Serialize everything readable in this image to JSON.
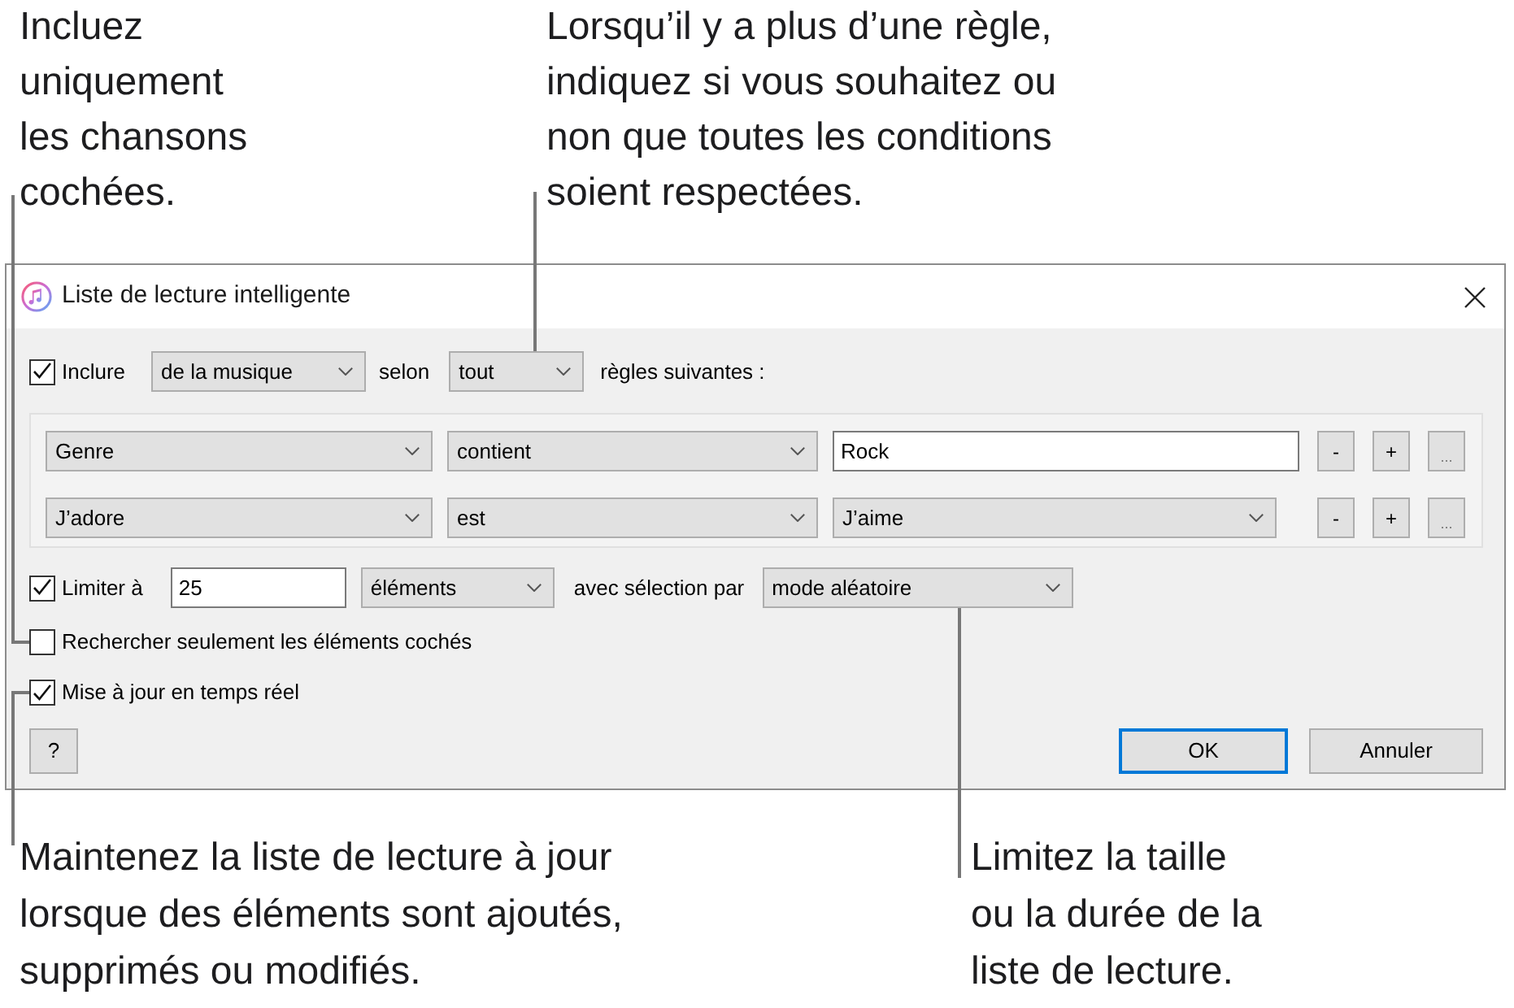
{
  "callouts_top": [
    {
      "lines": [
        "Incluez",
        "uniquement",
        "les chansons",
        "cochées."
      ]
    },
    {
      "lines": [
        "Lorsqu’il y a plus d’une règle,",
        "indiquez si vous souhaitez ou",
        "non que toutes les conditions",
        "soient respectées."
      ]
    }
  ],
  "dialog": {
    "title": "Liste de lecture intelligente",
    "include": {
      "checked": true,
      "label": "Inclure",
      "media": "de la musique",
      "connector": "selon",
      "match": "tout",
      "suffix": "règles suivantes :"
    },
    "rules": [
      {
        "kind": "text",
        "field": "Genre",
        "operator": "contient",
        "value": "Rock",
        "buttons": [
          "-",
          "+",
          "..."
        ]
      },
      {
        "kind": "choice",
        "field": "J’adore",
        "operator": "est",
        "value": "J’aime",
        "buttons": [
          "-",
          "+",
          "..."
        ]
      }
    ],
    "limit": {
      "checked": true,
      "label": "Limiter à",
      "amount": "25",
      "unit": "éléments",
      "selection_label": "avec sélection par",
      "selection": "mode aléatoire"
    },
    "only_checked": {
      "checked": false,
      "label": "Rechercher seulement les éléments cochés"
    },
    "live_update": {
      "checked": true,
      "label": "Mise à jour en temps réel"
    },
    "help_button": "?",
    "buttons": [
      {
        "label": "OK",
        "default": true
      },
      {
        "label": "Annuler",
        "default": false
      }
    ]
  },
  "callouts_bottom": [
    {
      "lines": [
        "Maintenez la liste de lecture à jour",
        "lorsque des éléments sont ajoutés,",
        "supprimés ou modifiés."
      ]
    },
    {
      "lines": [
        "Limitez la taille",
        "ou la durée de la",
        "liste de lecture."
      ]
    }
  ]
}
